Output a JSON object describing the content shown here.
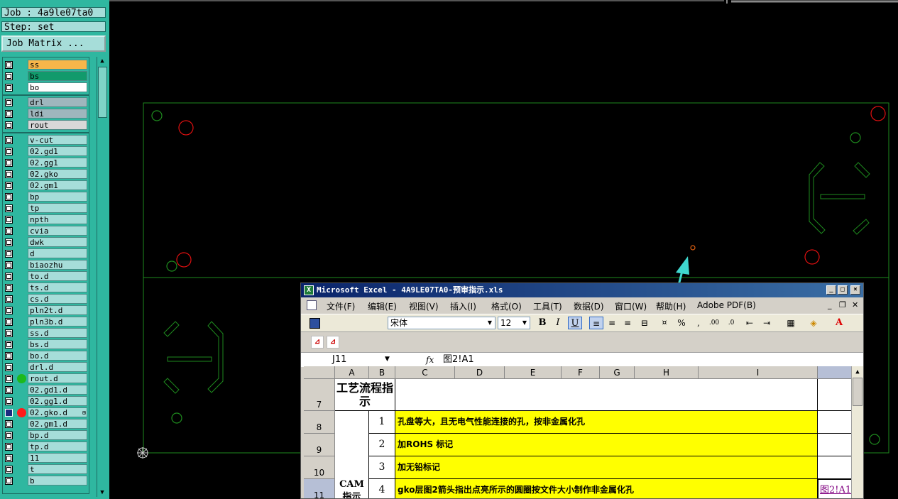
{
  "app": {
    "job_label": "Job : 4a9le07ta0",
    "step_label": "Step: set",
    "job_matrix_button": "Job Matrix ..."
  },
  "layers": {
    "group1": [
      {
        "name": "ss",
        "color": "#f7b64a"
      },
      {
        "name": "bs",
        "color": "#129a6c"
      },
      {
        "name": "bo",
        "color": "#ffffff"
      }
    ],
    "group2": [
      {
        "name": "drl",
        "color": "#9fb6bd"
      },
      {
        "name": "ldi",
        "color": "#9fb6bd"
      },
      {
        "name": "rout",
        "color": "#d8d8d8"
      }
    ],
    "group3": [
      {
        "name": "v-cut"
      },
      {
        "name": "02.gd1"
      },
      {
        "name": "02.gg1"
      },
      {
        "name": "02.gko"
      },
      {
        "name": "02.gm1"
      },
      {
        "name": "bp"
      },
      {
        "name": "tp"
      },
      {
        "name": "npth"
      },
      {
        "name": "cvia"
      },
      {
        "name": "dwk"
      },
      {
        "name": "d"
      },
      {
        "name": "biaozhu"
      },
      {
        "name": "to.d"
      },
      {
        "name": "ts.d"
      },
      {
        "name": "cs.d"
      },
      {
        "name": "pln2t.d"
      },
      {
        "name": "pln3b.d"
      },
      {
        "name": "ss.d"
      },
      {
        "name": "bs.d"
      },
      {
        "name": "bo.d"
      },
      {
        "name": "drl.d"
      },
      {
        "name": "rout.d",
        "dot": "#1db91d"
      },
      {
        "name": "02.gd1.d"
      },
      {
        "name": "02.gg1.d"
      },
      {
        "name": "02.gko.d",
        "dot": "#ff1a1a",
        "checked": true,
        "mark": "⊞"
      },
      {
        "name": "02.gm1.d"
      },
      {
        "name": "bp.d"
      },
      {
        "name": "tp.d"
      },
      {
        "name": "11"
      },
      {
        "name": "t"
      },
      {
        "name": "b"
      }
    ]
  },
  "colors": {
    "panel_bg": "#2fb7a0",
    "canvas_bg": "#000000",
    "outline": "#1e8a1e",
    "pad_red": "#e01010",
    "arrow": "#3fd8cf",
    "excel_title": "#0a246a",
    "highlight_yellow": "#ffff00"
  },
  "excel": {
    "title": "Microsoft Excel - 4A9LE07TA0-预审指示.xls",
    "title_icon": "excel-icon",
    "menu": [
      "文件(F)",
      "编辑(E)",
      "视图(V)",
      "插入(I)",
      "格式(O)",
      "工具(T)",
      "数据(D)",
      "窗口(W)",
      "帮助(H)",
      "Adobe PDF(B)"
    ],
    "font_name": "宋体",
    "font_size": "12",
    "name_box": "J11",
    "fx": "fx",
    "formula": "图2!A1",
    "columns": [
      "A",
      "B",
      "C",
      "D",
      "E",
      "F",
      "G",
      "H",
      "I"
    ],
    "rows": [
      "7",
      "8",
      "9",
      "10",
      "11"
    ],
    "a7": "工艺流程指示",
    "a11": "CAM指示",
    "items": [
      {
        "num": "1",
        "text": "孔盘等大，且无电气性能连接的孔，按非金属化孔"
      },
      {
        "num": "2",
        "text": "加ROHS 标记"
      },
      {
        "num": "3",
        "text": "加无铅标记"
      },
      {
        "num": "4",
        "text": "gko层图2箭头指出点亮所示的圆圈按文件大小制作非金属化孔"
      }
    ],
    "link_text": "图2!A1"
  }
}
